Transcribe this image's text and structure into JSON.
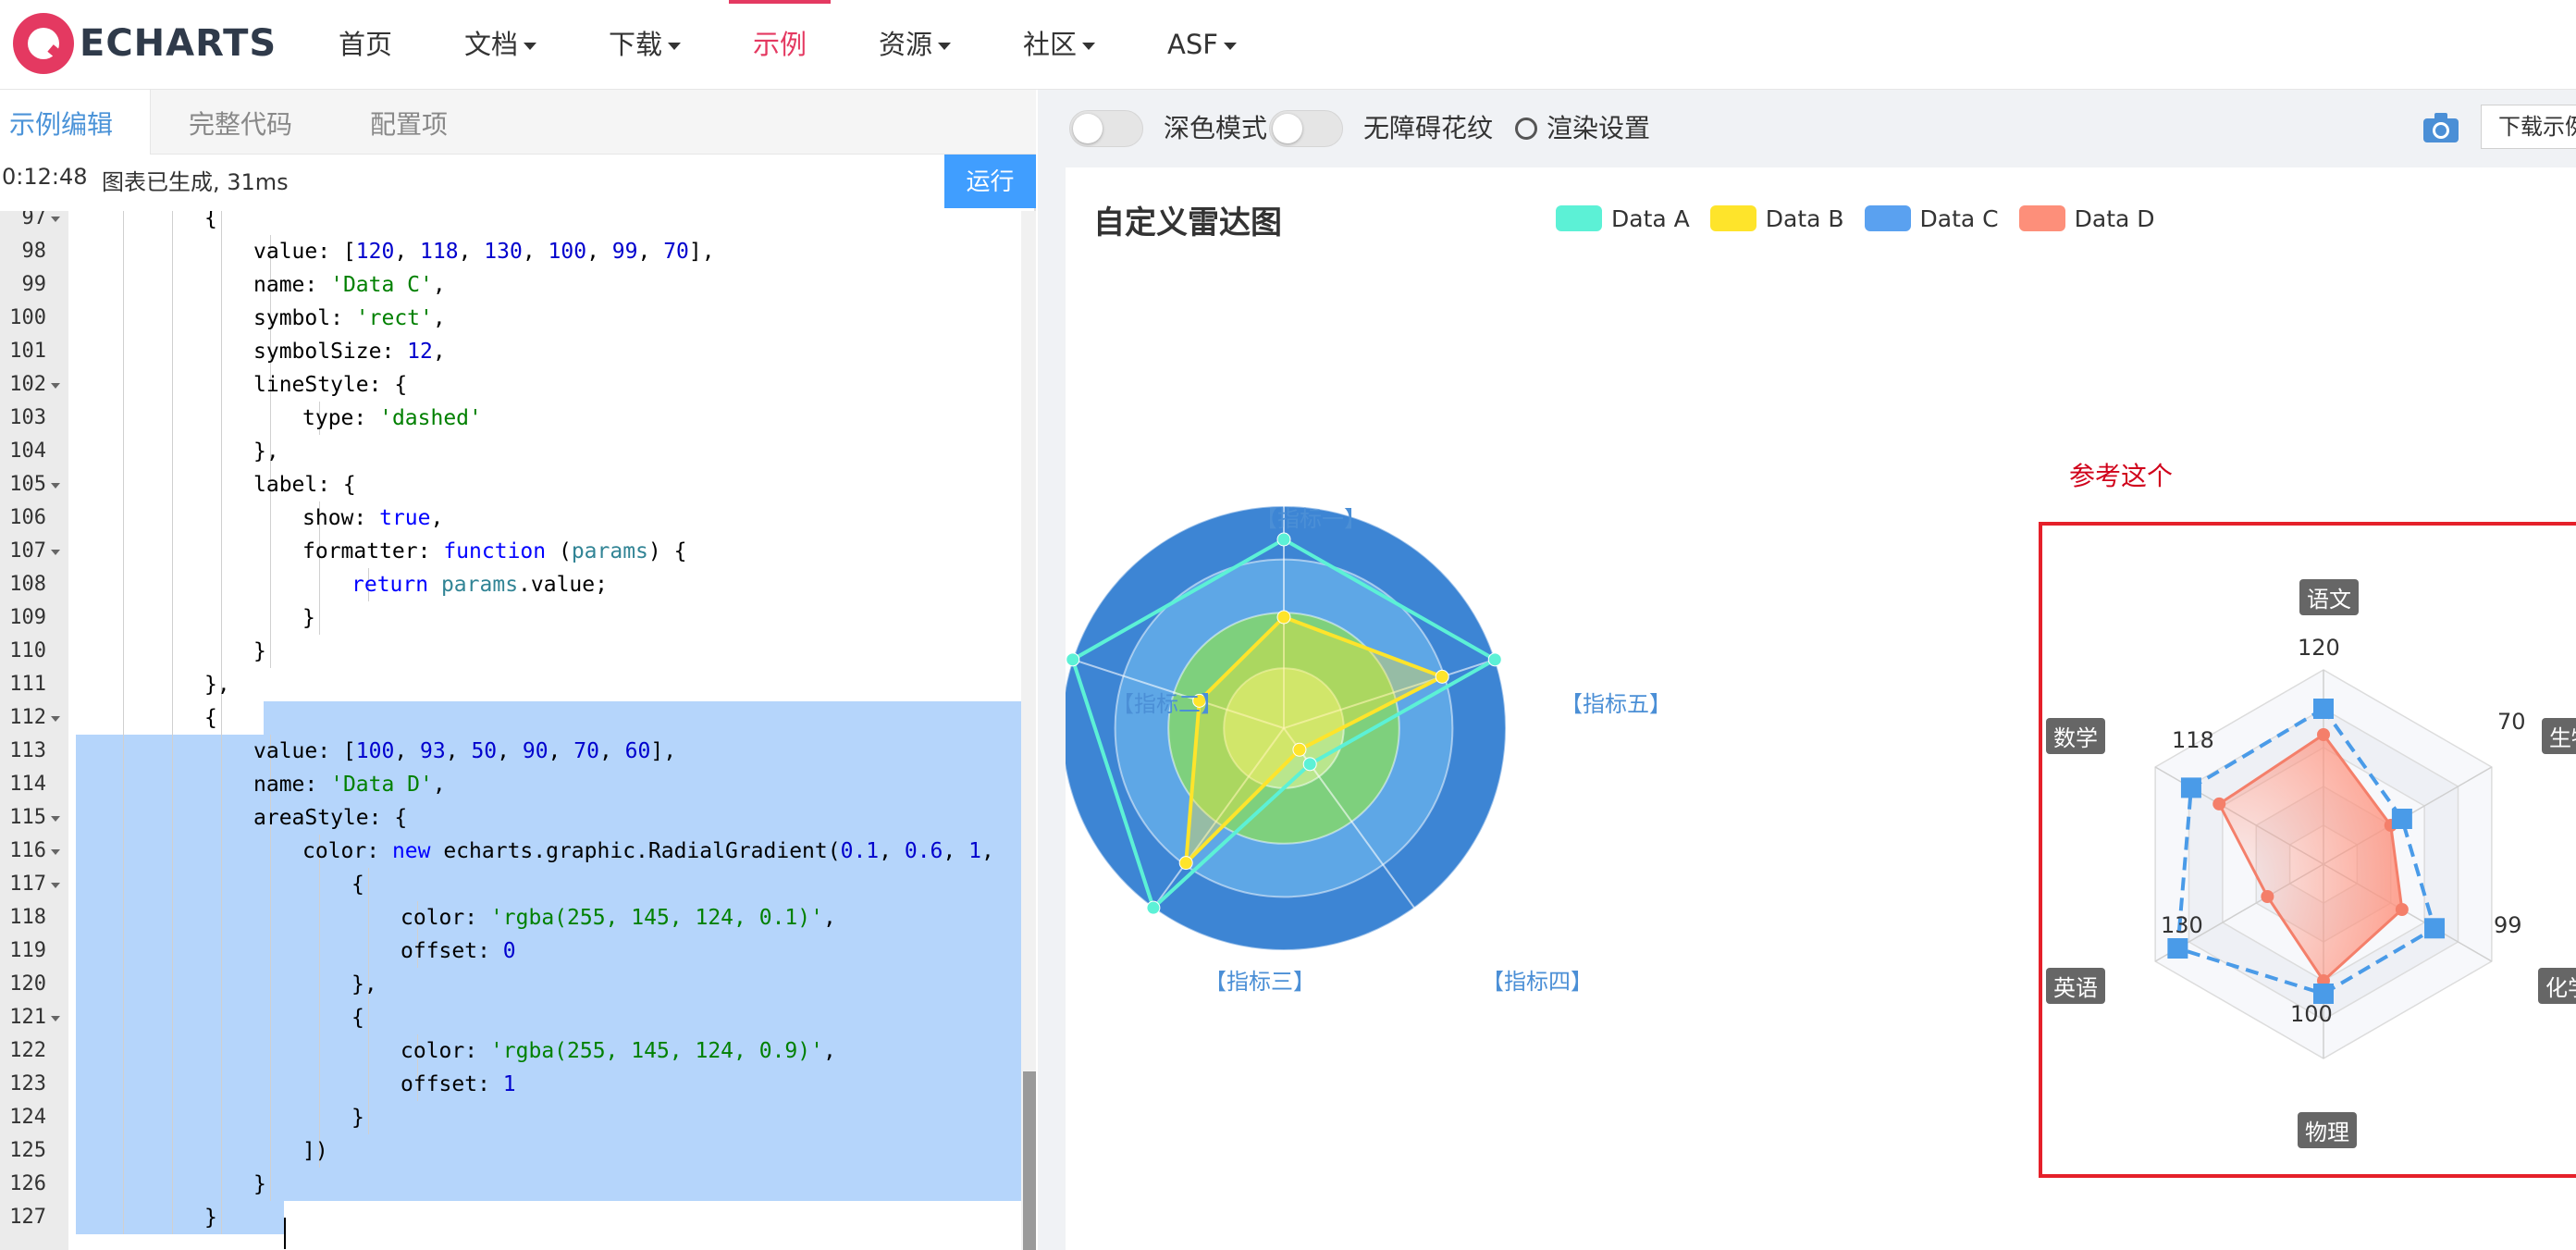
{
  "nav": {
    "logo_text": "ECHARTS",
    "items": [
      {
        "label": "首页",
        "dropdown": false,
        "active": false
      },
      {
        "label": "文档",
        "dropdown": true,
        "active": false
      },
      {
        "label": "下载",
        "dropdown": true,
        "active": false
      },
      {
        "label": "示例",
        "dropdown": false,
        "active": true
      },
      {
        "label": "资源",
        "dropdown": true,
        "active": false
      },
      {
        "label": "社区",
        "dropdown": true,
        "active": false
      },
      {
        "label": "ASF",
        "dropdown": true,
        "active": false
      }
    ],
    "accent_color": "#e43961"
  },
  "editor": {
    "tabs": [
      "示例编辑",
      "完整代码",
      "配置项"
    ],
    "status_time": "0:12:48",
    "status_text": "图表已生成, 31ms",
    "run_label": "运行",
    "lines": [
      {
        "n": 97,
        "fold": true,
        "indent": 4,
        "text": "{"
      },
      {
        "n": 98,
        "fold": false,
        "indent": 5,
        "text": "value: [120, 118, 130, 100, 99, 70],"
      },
      {
        "n": 99,
        "fold": false,
        "indent": 5,
        "text": "name: 'Data C',"
      },
      {
        "n": 100,
        "fold": false,
        "indent": 5,
        "text": "symbol: 'rect',"
      },
      {
        "n": 101,
        "fold": false,
        "indent": 5,
        "text": "symbolSize: 12,"
      },
      {
        "n": 102,
        "fold": true,
        "indent": 5,
        "text": "lineStyle: {"
      },
      {
        "n": 103,
        "fold": false,
        "indent": 6,
        "text": "type: 'dashed'"
      },
      {
        "n": 104,
        "fold": false,
        "indent": 5,
        "text": "},"
      },
      {
        "n": 105,
        "fold": true,
        "indent": 5,
        "text": "label: {"
      },
      {
        "n": 106,
        "fold": false,
        "indent": 6,
        "text": "show: true,"
      },
      {
        "n": 107,
        "fold": true,
        "indent": 6,
        "text": "formatter: function (params) {"
      },
      {
        "n": 108,
        "fold": false,
        "indent": 7,
        "text": "return params.value;"
      },
      {
        "n": 109,
        "fold": false,
        "indent": 6,
        "text": "}"
      },
      {
        "n": 110,
        "fold": false,
        "indent": 5,
        "text": "}"
      },
      {
        "n": 111,
        "fold": false,
        "indent": 4,
        "text": "},"
      },
      {
        "n": 112,
        "fold": true,
        "indent": 4,
        "text": "{"
      },
      {
        "n": 113,
        "fold": false,
        "indent": 5,
        "text": "value: [100, 93, 50, 90, 70, 60],"
      },
      {
        "n": 114,
        "fold": false,
        "indent": 5,
        "text": "name: 'Data D',"
      },
      {
        "n": 115,
        "fold": true,
        "indent": 5,
        "text": "areaStyle: {"
      },
      {
        "n": 116,
        "fold": true,
        "indent": 6,
        "text": "color: new echarts.graphic.RadialGradient(0.1, 0.6, 1,"
      },
      {
        "n": 117,
        "fold": true,
        "indent": 7,
        "text": "{"
      },
      {
        "n": 118,
        "fold": false,
        "indent": 8,
        "text": "color: 'rgba(255, 145, 124, 0.1)',"
      },
      {
        "n": 119,
        "fold": false,
        "indent": 8,
        "text": "offset: 0"
      },
      {
        "n": 120,
        "fold": false,
        "indent": 7,
        "text": "},"
      },
      {
        "n": 121,
        "fold": true,
        "indent": 7,
        "text": "{"
      },
      {
        "n": 122,
        "fold": false,
        "indent": 8,
        "text": "color: 'rgba(255, 145, 124, 0.9)',"
      },
      {
        "n": 123,
        "fold": false,
        "indent": 8,
        "text": "offset: 1"
      },
      {
        "n": 124,
        "fold": false,
        "indent": 7,
        "text": "}"
      },
      {
        "n": 125,
        "fold": false,
        "indent": 6,
        "text": "])"
      },
      {
        "n": 126,
        "fold": false,
        "indent": 5,
        "text": "}"
      },
      {
        "n": 127,
        "fold": false,
        "indent": 4,
        "text": "}"
      }
    ],
    "selected_from": 112,
    "selected_to": 127,
    "selection_color": "#b5d5fb"
  },
  "toolbar": {
    "dark_mode_label": "深色模式",
    "aria_label": "无障碍花纹",
    "render_settings_label": "渲染设置",
    "download_label": "下载示例"
  },
  "chart": {
    "title": "自定义雷达图",
    "legend": [
      {
        "name": "Data A",
        "color": "#5cf1d6"
      },
      {
        "name": "Data B",
        "color": "#fee42b"
      },
      {
        "name": "Data C",
        "color": "#5aa1f0"
      },
      {
        "name": "Data D",
        "color": "#fd8f7a"
      }
    ],
    "indicators": [
      "【指标一】",
      "【指标二】",
      "【指标三】",
      "【指标四】",
      "【指标五】"
    ],
    "ring_colors": [
      "#3d85d4",
      "#5ea7e6",
      "#7ed07d",
      "#b9e68d"
    ]
  },
  "reference": {
    "note": "参考这个",
    "indicators": [
      "语文",
      "数学",
      "英语",
      "物理",
      "化学",
      "生物"
    ],
    "labels_shown": [
      "120",
      "118",
      "130",
      "100",
      "99",
      "70"
    ]
  },
  "chart_data": [
    {
      "type": "radar",
      "title": "自定义雷达图",
      "indicators": [
        "【指标一】",
        "【指标二】",
        "【指标三】",
        "【指标四】",
        "【指标五】"
      ],
      "max": 100,
      "series": [
        {
          "name": "Data A",
          "color": "#5cf1d6",
          "values": [
            85,
            100,
            100,
            20,
            100
          ]
        },
        {
          "name": "Data B",
          "color": "#fee42b",
          "values": [
            50,
            40,
            75,
            12,
            75
          ]
        }
      ],
      "legend_position": "top-center"
    },
    {
      "type": "radar",
      "indicators": [
        "语文",
        "数学",
        "英语",
        "物理",
        "化学",
        "生物"
      ],
      "max": 150,
      "series": [
        {
          "name": "Data C",
          "color": "#4a9be8",
          "values": [
            120,
            118,
            130,
            100,
            99,
            70
          ],
          "dashed": true,
          "symbol": "rect"
        },
        {
          "name": "Data D",
          "color": "#f47f6a",
          "values": [
            100,
            93,
            50,
            90,
            70,
            60
          ],
          "area": true
        }
      ]
    }
  ]
}
